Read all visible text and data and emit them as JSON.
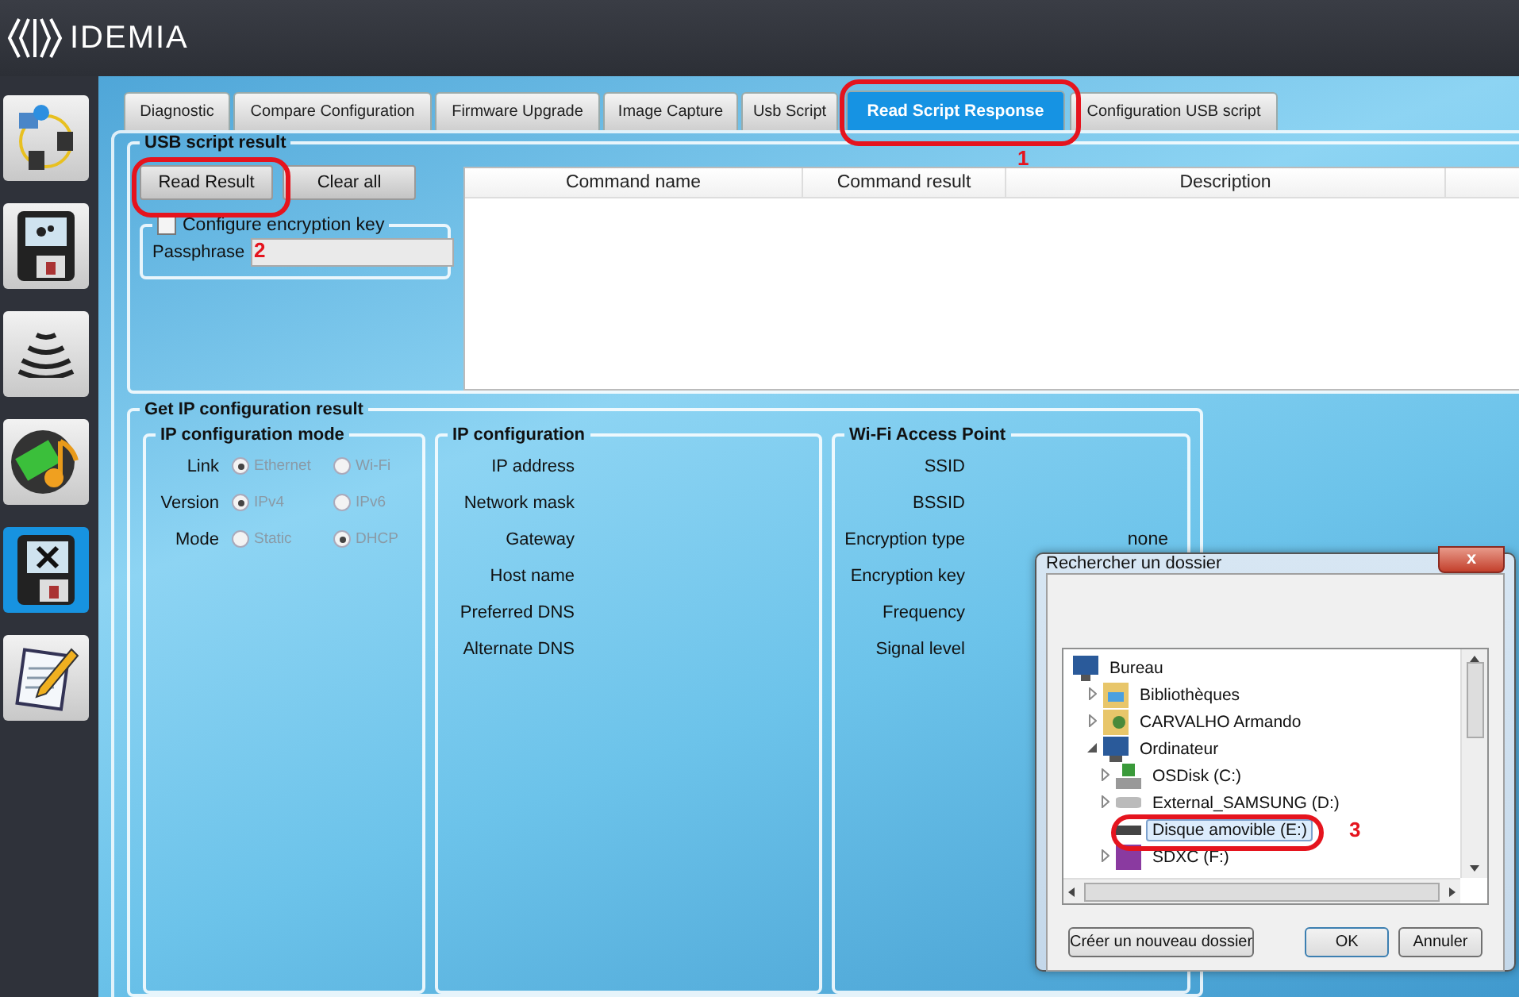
{
  "header": {
    "logo_text": "IDEMIA"
  },
  "sidebar": {
    "items": [
      {
        "kind": "network",
        "selected": false
      },
      {
        "kind": "terminal-settings",
        "selected": false
      },
      {
        "kind": "waves",
        "selected": false
      },
      {
        "kind": "media",
        "selected": false
      },
      {
        "kind": "terminal-tools",
        "selected": true
      },
      {
        "kind": "notepad",
        "selected": false
      }
    ]
  },
  "tabs": [
    {
      "label": "Diagnostic",
      "selected": false
    },
    {
      "label": "Compare Configuration",
      "selected": false
    },
    {
      "label": "Firmware Upgrade",
      "selected": false
    },
    {
      "label": "Image Capture",
      "selected": false
    },
    {
      "label": "Usb Script",
      "selected": false
    },
    {
      "label": "Read Script Response",
      "selected": true
    },
    {
      "label": "Configuration USB script",
      "selected": false
    }
  ],
  "usb_script_result": {
    "title": "USB script result",
    "buttons": [
      "Read Result",
      "Clear all"
    ],
    "encryption": {
      "label": "Configure encryption key",
      "checked": false
    },
    "passphrase": {
      "label": "Passphrase"
    },
    "table": {
      "columns": [
        "Command name",
        "Command result",
        "Description"
      ]
    }
  },
  "ip_result": {
    "title": "Get IP configuration result",
    "mode_group": {
      "title": "IP configuration mode",
      "rows": [
        {
          "label": "Link",
          "options": [
            {
              "label": "Ethernet",
              "selected": true
            },
            {
              "label": "Wi-Fi",
              "selected": false
            }
          ]
        },
        {
          "label": "Version",
          "options": [
            {
              "label": "IPv4",
              "selected": true
            },
            {
              "label": "IPv6",
              "selected": false
            }
          ]
        },
        {
          "label": "Mode",
          "options": [
            {
              "label": "Static",
              "selected": false
            },
            {
              "label": "DHCP",
              "selected": true
            }
          ]
        }
      ]
    },
    "ip_config": {
      "title": "IP configuration",
      "fields": [
        "IP address",
        "Network mask",
        "Gateway",
        "Host name",
        "Preferred DNS",
        "Alternate DNS"
      ]
    },
    "wifi": {
      "title": "Wi-Fi Access Point",
      "fields": [
        {
          "label": "SSID"
        },
        {
          "label": "BSSID"
        },
        {
          "label": "Encryption type",
          "value": "none"
        },
        {
          "label": "Encryption key"
        },
        {
          "label": "Frequency"
        },
        {
          "label": "Signal level"
        }
      ]
    }
  },
  "dialog": {
    "title": "Rechercher un dossier",
    "close": "x",
    "tree": [
      {
        "label": "Bureau",
        "kind": "desktop",
        "selected": false,
        "children": [
          {
            "label": "Bibliothèques",
            "kind": "library",
            "expanded": false,
            "selected": false
          },
          {
            "label": "CARVALHO Armando",
            "kind": "user",
            "expanded": false,
            "selected": false
          },
          {
            "label": "Ordinateur",
            "kind": "computer",
            "expanded": true,
            "selected": false,
            "children": [
              {
                "label": "OSDisk (C:)",
                "kind": "system-disk",
                "expanded": false,
                "selected": false
              },
              {
                "label": "External_SAMSUNG (D:)",
                "kind": "drive",
                "expanded": false,
                "selected": false
              },
              {
                "label": "Disque amovible (E:)",
                "kind": "removable",
                "selected": true
              },
              {
                "label": "SDXC (F:)",
                "kind": "sd",
                "expanded": false,
                "selected": false
              }
            ]
          }
        ]
      }
    ],
    "buttons": [
      {
        "label": "Créer un nouveau dossier",
        "default": false
      },
      {
        "label": "OK",
        "default": true
      },
      {
        "label": "Annuler",
        "default": false
      }
    ]
  },
  "annotations": [
    {
      "number": "1"
    },
    {
      "number": "2"
    },
    {
      "number": "3"
    }
  ]
}
